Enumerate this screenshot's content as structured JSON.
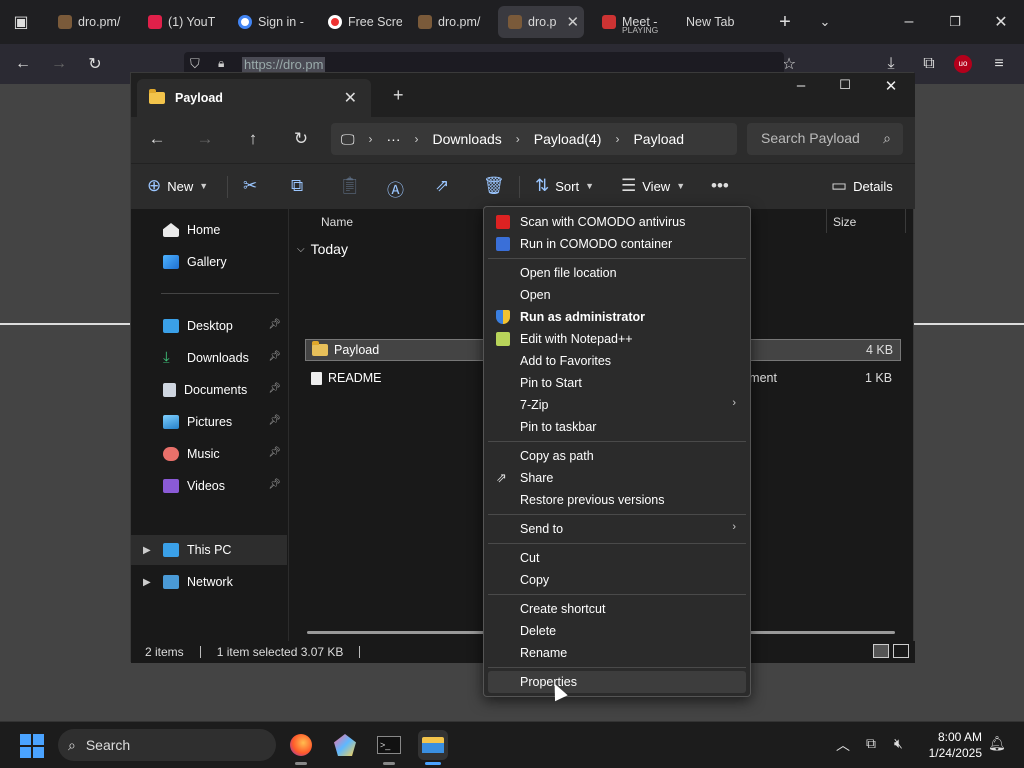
{
  "browser": {
    "tabs": [
      {
        "label": "dro.pm/",
        "icon": "dro-favicon"
      },
      {
        "label": "(1) YouT",
        "icon": "youtube-favicon"
      },
      {
        "label": "Sign in -",
        "icon": "google-favicon"
      },
      {
        "label": "Free Scre",
        "icon": "record-favicon"
      },
      {
        "label": "dro.pm/",
        "icon": "dro-favicon"
      },
      {
        "label": "dro.p",
        "icon": "dro-favicon"
      },
      {
        "label": "Meet - ",
        "sub": "PLAYING",
        "icon": "meet-favicon"
      },
      {
        "label": "New Tab",
        "icon": "none"
      }
    ],
    "url": "https://dro.pm"
  },
  "explorer": {
    "tab_title": "Payload",
    "breadcrumbs": [
      "Downloads",
      "Payload(4)",
      "Payload"
    ],
    "search_placeholder": "Search Payload",
    "toolbar": {
      "new": "New",
      "sort": "Sort",
      "view": "View",
      "details": "Details"
    },
    "nav": {
      "home": "Home",
      "gallery": "Gallery",
      "desktop": "Desktop",
      "downloads": "Downloads",
      "documents": "Documents",
      "pictures": "Pictures",
      "music": "Music",
      "videos": "Videos",
      "this_pc": "This PC",
      "network": "Network"
    },
    "columns": {
      "name": "Name",
      "size": "Size"
    },
    "group": "Today",
    "files": [
      {
        "name": "Payload",
        "type": "t",
        "size": "4 KB"
      },
      {
        "name": "README",
        "type": "ocument",
        "size": "1 KB"
      }
    ],
    "status": {
      "count": "2 items",
      "selected": "1 item selected  3.07 KB"
    }
  },
  "context_menu": {
    "items": [
      "Scan with COMODO antivirus",
      "Run in COMODO container",
      "Open file location",
      "Open",
      "Run as administrator",
      "Edit with Notepad++",
      "Add to Favorites",
      "Pin to Start",
      "7-Zip",
      "Pin to taskbar",
      "Copy as path",
      "Share",
      "Restore previous versions",
      "Send to",
      "Cut",
      "Copy",
      "Create shortcut",
      "Delete",
      "Rename",
      "Properties"
    ]
  },
  "taskbar": {
    "search": "Search",
    "time": "8:00 AM",
    "date": "1/24/2025"
  },
  "colors": {
    "accent": "#4aa3ff",
    "folder": "#f3c44b",
    "menu_bg": "#2b2b2b"
  }
}
